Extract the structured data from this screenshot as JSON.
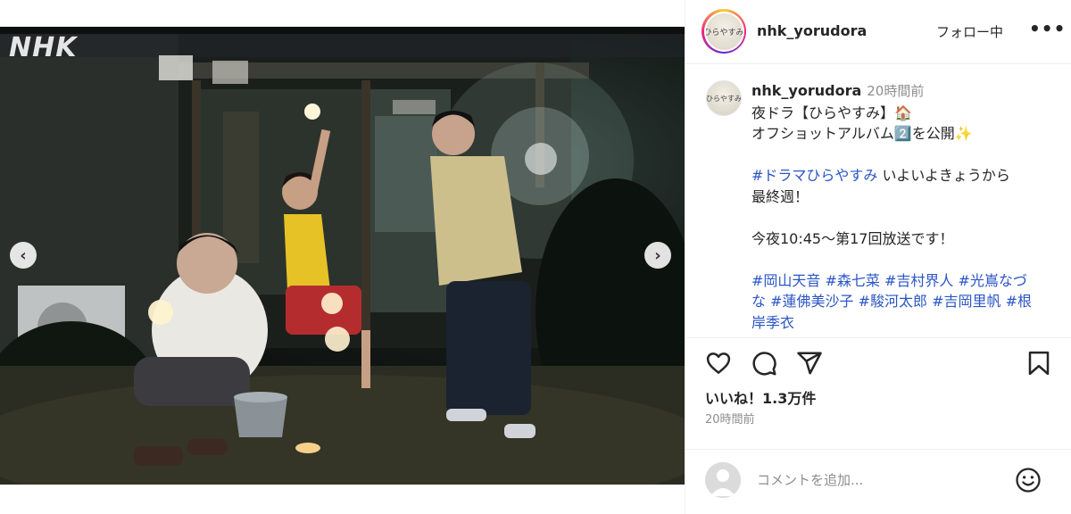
{
  "media": {
    "watermark": "NHK",
    "prev_glyph": "‹",
    "next_glyph": "›",
    "carousel": {
      "total": 10,
      "active_index": 3
    }
  },
  "header": {
    "username": "nhk_yorudora",
    "follow_label": "フォロー中",
    "more_glyph": "•••",
    "avatar_text": "ひらやすみ"
  },
  "caption": {
    "username": "nhk_yorudora",
    "time": "20時間前",
    "line1": "夜ドラ【ひらやすみ】🏠",
    "line2": "オフショットアルバム2️⃣を公開✨",
    "hashtag_show": "#ドラマひらやすみ",
    "line3_rest": " いよいよきょうから",
    "line4": "最終週！",
    "line5": "今夜10:45〜第17回放送です！",
    "tags_line1": "#岡山天音 #森七菜 #吉村界人 #光嶌なづ",
    "tags_line2": "な #蓮佛美沙子 #駿河太郎 #吉岡里帆 #根",
    "tags_line3": "岸季衣"
  },
  "actions": {
    "icons": [
      "heart-icon",
      "comment-icon",
      "share-icon",
      "bookmark-icon"
    ]
  },
  "likes": "いいね！1.3万件",
  "post_time": "20時間前",
  "comment": {
    "placeholder": "コメントを追加..."
  },
  "colors": {
    "text": "#262626",
    "muted": "#8e8e8e",
    "hashtag": "#2b56c5",
    "divider": "#efefef"
  }
}
